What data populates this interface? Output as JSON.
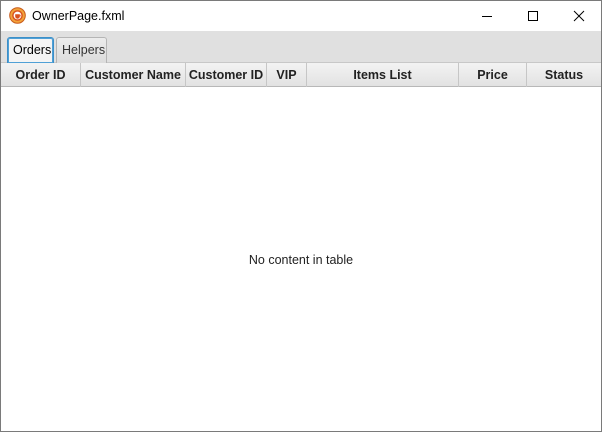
{
  "window": {
    "title": "OwnerPage.fxml",
    "icon": "java-coffee-icon"
  },
  "tabs": [
    {
      "label": "Orders",
      "selected": true
    },
    {
      "label": "Helpers",
      "selected": false
    }
  ],
  "table": {
    "columns": [
      "Order ID",
      "Customer Name",
      "Customer ID",
      "VIP",
      "Items List",
      "Price",
      "Status"
    ],
    "rows": [],
    "placeholder": "No content in table"
  },
  "colors": {
    "tab_focus": "#4fa0d6",
    "tab_strip": "#e0e0e0",
    "icon_accent": "#e8742a"
  }
}
